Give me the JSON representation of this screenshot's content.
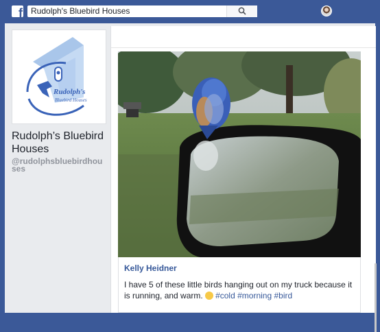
{
  "topbar": {
    "logo_letter": "f",
    "search_value": "Rudolph's Bluebird Houses"
  },
  "page": {
    "logo_text_main": "Rudolph's",
    "logo_text_sub": "Bluebird Houses",
    "name": "Rudolph’s Bluebird Houses",
    "handle": "@rudolphsbluebirdhouses"
  },
  "post": {
    "author": "Kelly Heidner",
    "text_before": "I have 5 of these little birds hanging out on my truck because it is running, and warm.",
    "tags": [
      "#cold",
      "#morning",
      "#bird"
    ]
  },
  "colors": {
    "brand": "#3b5998",
    "link": "#365899",
    "logo_blue": "#3a63b8"
  }
}
